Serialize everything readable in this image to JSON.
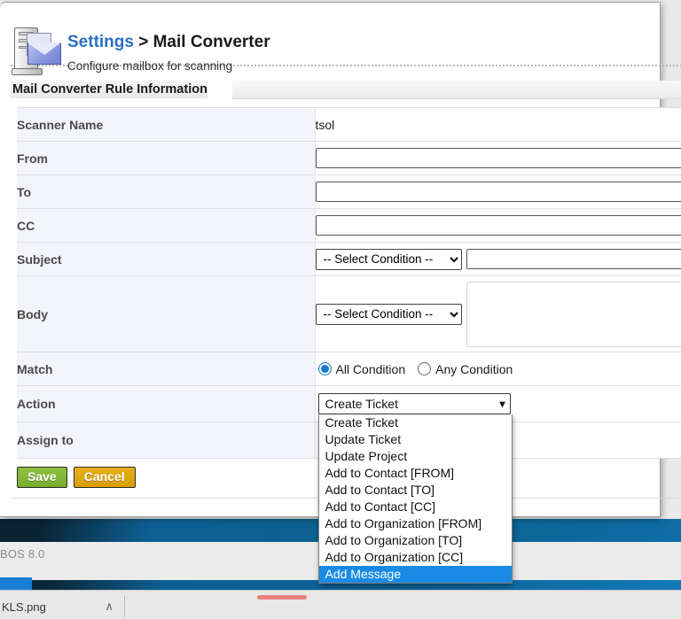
{
  "header": {
    "breadcrumb_parent": "Settings",
    "breadcrumb_separator": "> ",
    "breadcrumb_current": "Mail Converter",
    "subtitle": "Configure mailbox for scanning",
    "icon": "mail-server-icon"
  },
  "block": {
    "title": "Mail Converter Rule Information"
  },
  "fields": {
    "scanner_name": {
      "label": "Scanner Name",
      "value": "tsol"
    },
    "from": {
      "label": "From",
      "value": "",
      "placeholder": ""
    },
    "to": {
      "label": "To",
      "value": "",
      "placeholder": ""
    },
    "cc": {
      "label": "CC",
      "value": "",
      "placeholder": ""
    },
    "subject": {
      "label": "Subject",
      "condition_selected": "-- Select Condition --",
      "value": "",
      "placeholder": ""
    },
    "body": {
      "label": "Body",
      "condition_selected": "-- Select Condition --",
      "value": "",
      "placeholder": ""
    },
    "match": {
      "label": "Match",
      "options": [
        "All Condition",
        "Any Condition"
      ],
      "selected": "All Condition"
    },
    "action": {
      "label": "Action",
      "selected": "Create Ticket",
      "dropdown_open": true,
      "highlighted": "Add Message",
      "options": [
        "Create Ticket",
        "Update Ticket",
        "Update Project",
        "Add to Contact [FROM]",
        "Add to Contact [TO]",
        "Add to Contact [CC]",
        "Add to Organization [FROM]",
        "Add to Organization [TO]",
        "Add to Organization [CC]",
        "Add Message"
      ]
    },
    "assign_to": {
      "label": "Assign to",
      "value": ""
    }
  },
  "condition_options": [
    "-- Select Condition --"
  ],
  "buttons": {
    "save": "Save",
    "cancel": "Cancel"
  },
  "footer": {
    "version_text": "BOS 8.0"
  },
  "downloads": {
    "file_name": "KLS.png",
    "caret": "∧"
  },
  "colors": {
    "link": "#2b6fc4",
    "label_bg": "#f4f5fb",
    "save_green": "#8fc03e",
    "cancel_amber": "#e7b01c",
    "dropdown_highlight": "#1a8ae5",
    "radio_accent": "#1876d2"
  }
}
